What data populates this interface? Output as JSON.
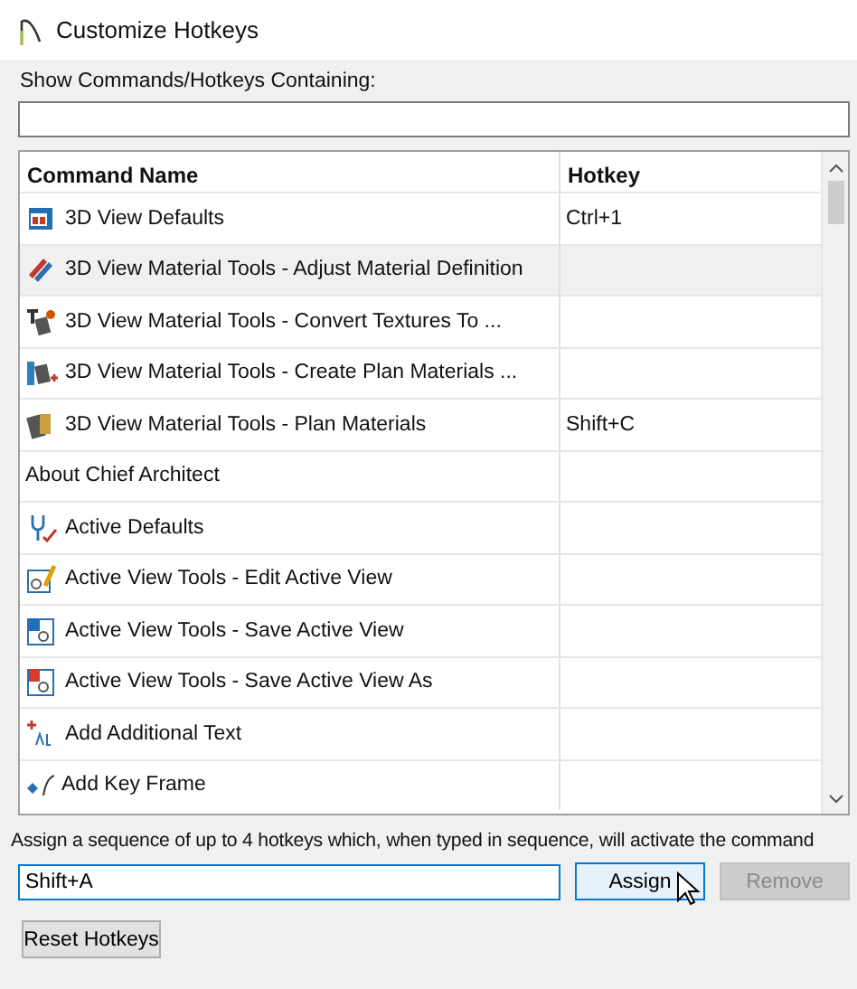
{
  "window": {
    "title": "Customize Hotkeys"
  },
  "filter": {
    "label": "Show Commands/Hotkeys Containing:"
  },
  "table": {
    "columns": [
      "Command Name",
      "Hotkey"
    ],
    "rows": [
      {
        "name": "3D View Defaults",
        "hotkey": "Ctrl+1",
        "selected": false
      },
      {
        "name": "3D View Material Tools - Adjust Material Definition",
        "selected": true
      },
      {
        "name": "3D View Material Tools - Convert Textures To ...",
        "selected": false
      },
      {
        "name": "3D View Material Tools - Create Plan Materials ...",
        "selected": false
      },
      {
        "name": "3D View Material Tools - Plan Materials",
        "hotkey": "Shift+C",
        "selected": false
      },
      {
        "name": "About Chief Architect",
        "selected": false
      },
      {
        "name": "Active Defaults",
        "selected": false
      },
      {
        "name": "Active View Tools - Edit Active View",
        "selected": false
      },
      {
        "name": "Active View Tools - Save Active View",
        "selected": false
      },
      {
        "name": "Active View Tools - Save Active View As",
        "selected": false
      },
      {
        "name": "Add Additional Text",
        "selected": false
      },
      {
        "name": "Add Key Frame",
        "selected": false
      }
    ]
  },
  "assign": {
    "hint": "Assign a sequence of up to 4 hotkeys which, when typed in sequence, will activate the command",
    "value": "Shift+A",
    "buttons": [
      {
        "label": "Assign",
        "disabled": false
      },
      {
        "label": "Remove",
        "disabled": true
      }
    ]
  },
  "reset_button": "Reset Hotkeys"
}
